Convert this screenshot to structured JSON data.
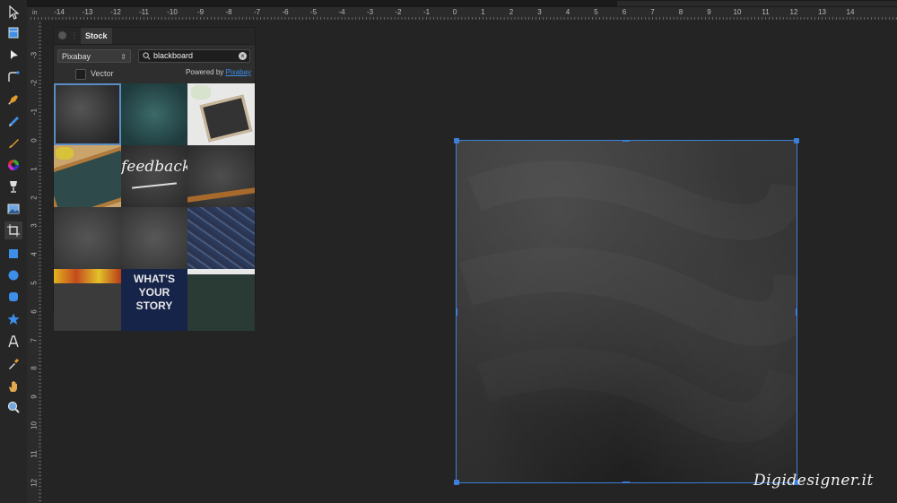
{
  "ruler": {
    "unit": "in",
    "h_labels": [
      "-14",
      "-13",
      "-12",
      "-11",
      "-10",
      "-9",
      "-8",
      "-7",
      "-6",
      "-5",
      "-4",
      "-3",
      "-2",
      "-1",
      "0",
      "1",
      "2",
      "3",
      "4",
      "5",
      "6",
      "7",
      "8",
      "9",
      "10",
      "11",
      "12",
      "13",
      "14"
    ],
    "v_labels": [
      "-3",
      "-2",
      "-1",
      "0",
      "1",
      "2",
      "3",
      "4",
      "5",
      "6",
      "7",
      "8",
      "9",
      "10",
      "11",
      "12"
    ]
  },
  "toolbar": {
    "tools": [
      {
        "name": "move-tool",
        "icon": "pointer-arrow-icon"
      },
      {
        "name": "artboard-tool",
        "icon": "artboard-icon"
      },
      {
        "name": "node-tool",
        "icon": "node-pointer-icon"
      },
      {
        "name": "corner-tool",
        "icon": "corner-icon"
      },
      {
        "name": "pen-tool",
        "icon": "pen-icon"
      },
      {
        "name": "pencil-tool",
        "icon": "pencil-icon"
      },
      {
        "name": "brush-tool",
        "icon": "brush-icon"
      },
      {
        "name": "fill-tool",
        "icon": "color-wheel-icon"
      },
      {
        "name": "transparency-tool",
        "icon": "wine-glass-icon"
      },
      {
        "name": "place-image-tool",
        "icon": "image-icon"
      },
      {
        "name": "crop-tool",
        "icon": "crop-icon"
      },
      {
        "name": "rectangle-tool",
        "icon": "rectangle-icon"
      },
      {
        "name": "ellipse-tool",
        "icon": "ellipse-icon"
      },
      {
        "name": "rounded-rectangle-tool",
        "icon": "rounded-rectangle-icon"
      },
      {
        "name": "star-tool",
        "icon": "star-icon"
      },
      {
        "name": "text-tool",
        "icon": "text-icon"
      },
      {
        "name": "color-picker-tool",
        "icon": "eyedropper-icon"
      },
      {
        "name": "view-tool",
        "icon": "hand-icon"
      },
      {
        "name": "zoom-tool",
        "icon": "zoom-icon"
      }
    ],
    "accent": "#3d8ee8"
  },
  "stock_panel": {
    "tab_label": "Stock",
    "provider": "Pixabay",
    "search_value": "blackboard",
    "vector_label": "Vector",
    "vector_checked": false,
    "powered_by_label": "Powered by",
    "powered_by_link": "Pixabay",
    "thumbs": [
      {
        "caption": ""
      },
      {
        "caption": ""
      },
      {
        "caption": ""
      },
      {
        "caption": ""
      },
      {
        "caption": "feedback"
      },
      {
        "caption": ""
      },
      {
        "caption": ""
      },
      {
        "caption": ""
      },
      {
        "caption": ""
      },
      {
        "caption": ""
      },
      {
        "caption": "WHAT'S YOUR STORY"
      },
      {
        "caption": ""
      }
    ]
  },
  "watermark": {
    "text": "Digidesigner.it"
  },
  "colors": {
    "selection": "#3d7fd8",
    "canvas": "#242424",
    "artboard": "#333333"
  }
}
